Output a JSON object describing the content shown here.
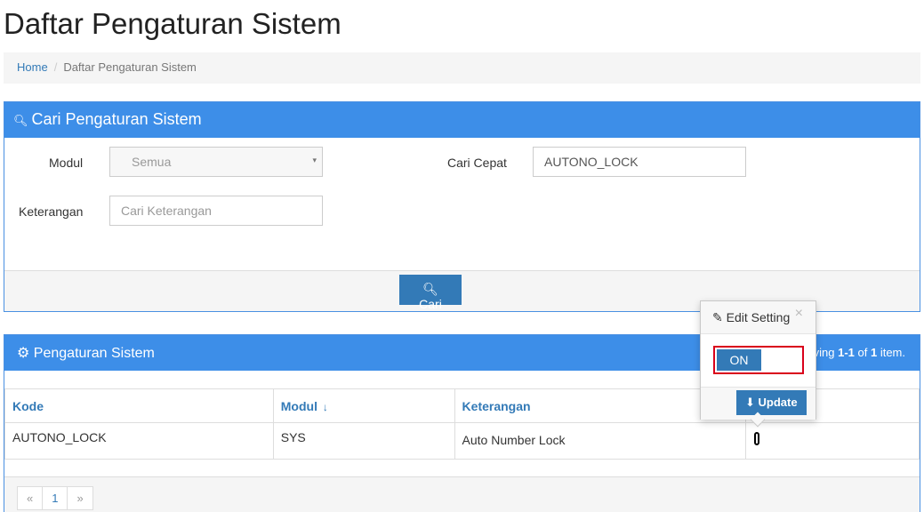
{
  "page": {
    "title": "Daftar Pengaturan Sistem"
  },
  "breadcrumb": {
    "home": "Home",
    "sep": "/",
    "current": "Daftar Pengaturan Sistem"
  },
  "search_panel": {
    "title": "Cari Pengaturan Sistem",
    "search_icon": "search-icon",
    "modul_label": "Modul",
    "modul_value": "Semua",
    "caret": "▾",
    "cari_cepat_label": "Cari Cepat",
    "cari_cepat_value": "AUTONO_LOCK",
    "keterangan_label": "Keterangan",
    "keterangan_placeholder": "Cari Keterangan",
    "submit_label": "Cari"
  },
  "grid_panel": {
    "title": "Pengaturan Sistem",
    "summary_prefix": "ving ",
    "summary_range": "1-1",
    "summary_of": " of ",
    "summary_total": "1",
    "summary_suffix": " item.",
    "columns": {
      "kode": "Kode",
      "modul": "Modul",
      "keterangan": "Keterangan"
    },
    "sort_icon_text": "↓",
    "rows": [
      {
        "kode": "AUTONO_LOCK",
        "modul": "SYS",
        "keterangan": "Auto Number Lock"
      }
    ],
    "pagination": {
      "prev": "«",
      "current": "1",
      "next": "»"
    }
  },
  "popover": {
    "title": "Edit Setting",
    "close": "×",
    "toggle_on_label": "ON",
    "toggle_state": "on",
    "update_label": "Update"
  },
  "colors": {
    "panel_header": "#3d8ee8",
    "primary": "#337ab7",
    "highlight": "#d9001b"
  }
}
